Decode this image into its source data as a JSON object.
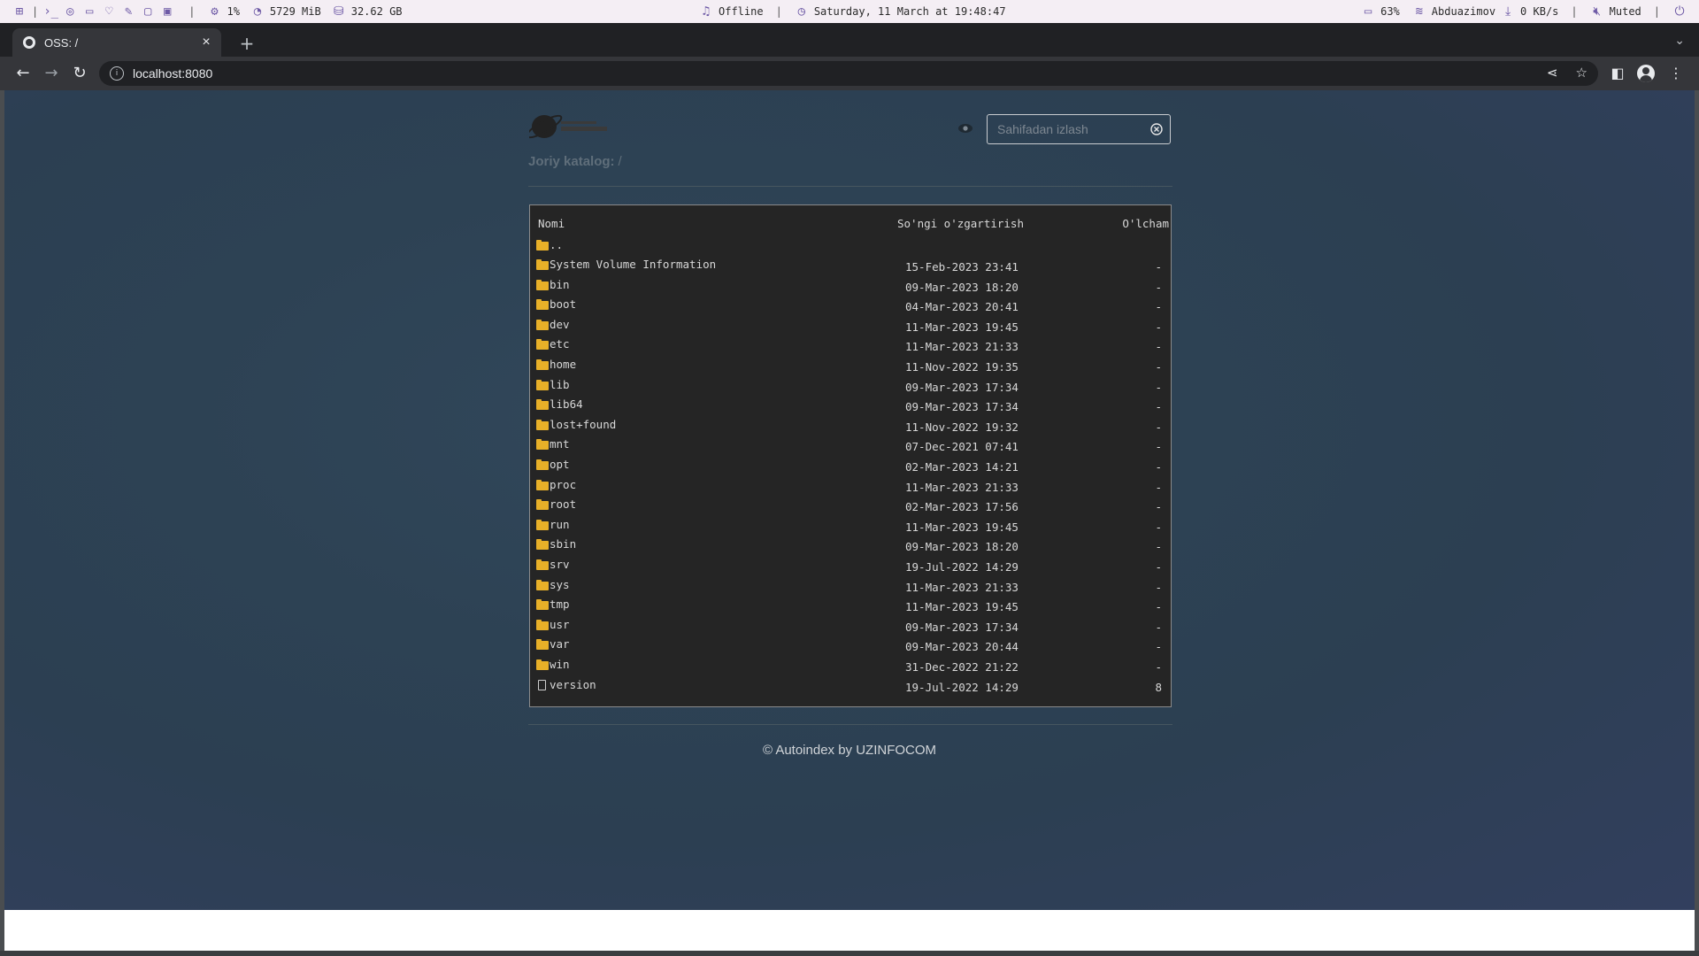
{
  "system_bar": {
    "separator": "|",
    "cpu": "1%",
    "memory": "5729 MiB",
    "disk": "32.62 GB",
    "network_status": "Offline",
    "datetime": "Saturday, 11 March at 19:48:47",
    "battery": "63%",
    "wifi": "Abduazimov",
    "net_speed": "0 KB/s",
    "volume": "Muted"
  },
  "browser": {
    "tab_title": "OSS: /",
    "tab_close": "×",
    "new_tab": "+",
    "url": "localhost:8080"
  },
  "page": {
    "search_placeholder": "Sahifadan izlash",
    "breadcrumb_label": "Joriy katalog:",
    "breadcrumb_path": "/",
    "columns": {
      "name": "Nomi",
      "modified": "So'ngi o'zgartirish",
      "size": "O'lcham"
    },
    "parent_dir": "..",
    "entries": [
      {
        "name": "System Volume Information",
        "date": "15-Feb-2023 23:41",
        "size": "-",
        "type": "folder"
      },
      {
        "name": "bin",
        "date": "09-Mar-2023 18:20",
        "size": "-",
        "type": "folder"
      },
      {
        "name": "boot",
        "date": "04-Mar-2023 20:41",
        "size": "-",
        "type": "folder"
      },
      {
        "name": "dev",
        "date": "11-Mar-2023 19:45",
        "size": "-",
        "type": "folder"
      },
      {
        "name": "etc",
        "date": "11-Mar-2023 21:33",
        "size": "-",
        "type": "folder"
      },
      {
        "name": "home",
        "date": "11-Nov-2022 19:35",
        "size": "-",
        "type": "folder"
      },
      {
        "name": "lib",
        "date": "09-Mar-2023 17:34",
        "size": "-",
        "type": "folder"
      },
      {
        "name": "lib64",
        "date": "09-Mar-2023 17:34",
        "size": "-",
        "type": "folder"
      },
      {
        "name": "lost+found",
        "date": "11-Nov-2022 19:32",
        "size": "-",
        "type": "folder"
      },
      {
        "name": "mnt",
        "date": "07-Dec-2021 07:41",
        "size": "-",
        "type": "folder"
      },
      {
        "name": "opt",
        "date": "02-Mar-2023 14:21",
        "size": "-",
        "type": "folder"
      },
      {
        "name": "proc",
        "date": "11-Mar-2023 21:33",
        "size": "-",
        "type": "folder"
      },
      {
        "name": "root",
        "date": "02-Mar-2023 17:56",
        "size": "-",
        "type": "folder"
      },
      {
        "name": "run",
        "date": "11-Mar-2023 19:45",
        "size": "-",
        "type": "folder"
      },
      {
        "name": "sbin",
        "date": "09-Mar-2023 18:20",
        "size": "-",
        "type": "folder"
      },
      {
        "name": "srv",
        "date": "19-Jul-2022 14:29",
        "size": "-",
        "type": "folder"
      },
      {
        "name": "sys",
        "date": "11-Mar-2023 21:33",
        "size": "-",
        "type": "folder"
      },
      {
        "name": "tmp",
        "date": "11-Mar-2023 19:45",
        "size": "-",
        "type": "folder"
      },
      {
        "name": "usr",
        "date": "09-Mar-2023 17:34",
        "size": "-",
        "type": "folder"
      },
      {
        "name": "var",
        "date": "09-Mar-2023 20:44",
        "size": "-",
        "type": "folder"
      },
      {
        "name": "win",
        "date": "31-Dec-2022 21:22",
        "size": "-",
        "type": "folder"
      },
      {
        "name": "version",
        "date": "19-Jul-2022 14:29",
        "size": "8",
        "type": "file"
      }
    ],
    "footer": "© Autoindex by UZINFOCOM"
  },
  "colors": {
    "accent": "#6e5aa6",
    "folder": "#e8b028",
    "listing_bg": "#252525"
  }
}
